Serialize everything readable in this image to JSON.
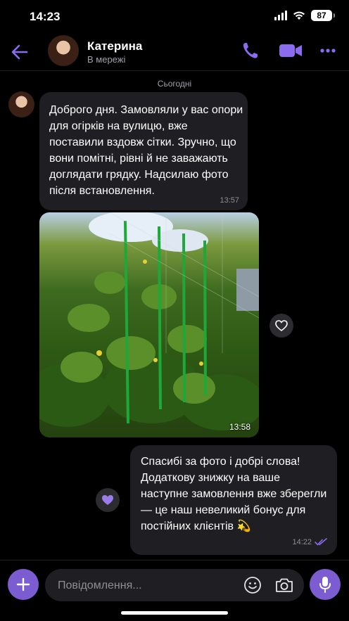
{
  "status_bar": {
    "time": "14:23",
    "battery": "87"
  },
  "header": {
    "contact_name": "Катерина",
    "contact_status": "В мережі"
  },
  "date_separator": "Сьогодні",
  "messages": [
    {
      "direction": "incoming",
      "text": "Доброго дня. Замовляли у вас опори для огірків на вулицю, вже поставили вздовж сітки. Зручно, що вони помітні, рівні й не заважають доглядати грядку. Надсилаю фото після встановлення.",
      "time": "13:57"
    },
    {
      "direction": "incoming",
      "type": "photo",
      "time": "13:58"
    },
    {
      "direction": "outgoing",
      "text": "Спасибі за фото і добрі слова! Додаткову знижку на ваше наступне замовлення вже зберегли — це наш невеликий бонус для постійних клієнтів 💫",
      "time": "14:22",
      "status": "read"
    }
  ],
  "composer": {
    "placeholder": "Повідомлення..."
  },
  "colors": {
    "accent": "#7c5cd1",
    "bubble": "#1f1f23",
    "background": "#000000"
  }
}
